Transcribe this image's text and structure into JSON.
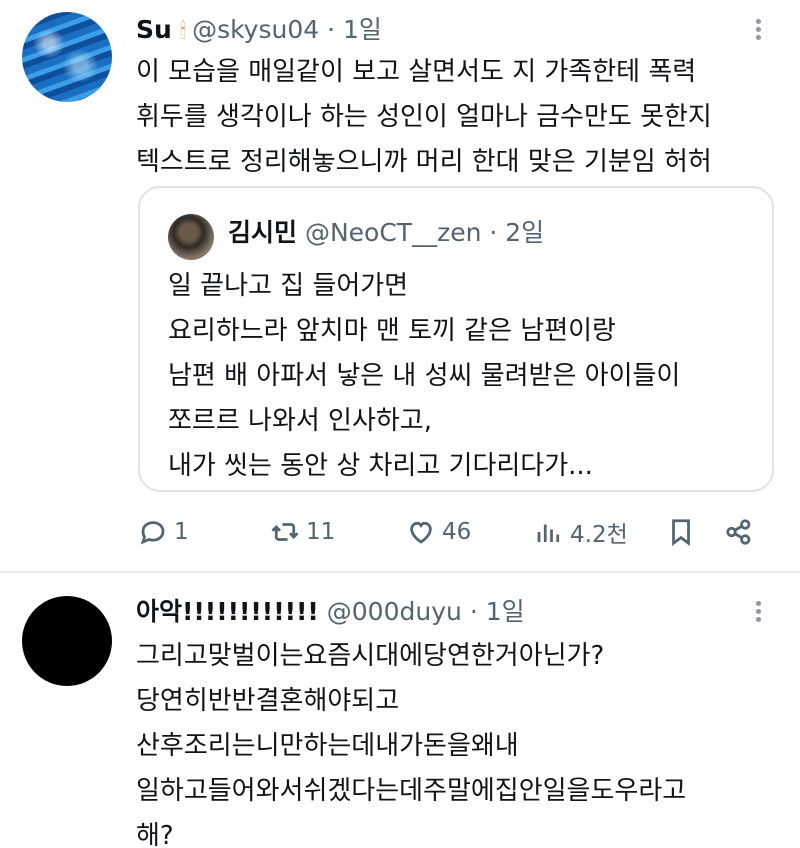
{
  "tweet1": {
    "name": "Su",
    "handle": "@skysu04",
    "separator": "·",
    "time": "1일",
    "lines": [
      "이 모습을 매일같이 보고 살면서도 지 가족한테 폭력",
      "휘두를 생각이나 하는 성인이 얼마나 금수만도 못한지",
      "텍스트로 정리해놓으니까 머리 한대 맞은 기분임 허허"
    ],
    "quote": {
      "name": "김시민",
      "handle": "@NeoCT__zen",
      "separator": "·",
      "time": "2일",
      "lines": [
        "일 끝나고 집 들어가면",
        "요리하느라 앞치마 맨 토끼 같은 남편이랑",
        "남편 배 아파서 낳은 내 성씨 물려받은 아이들이",
        "쪼르르 나와서 인사하고,",
        "내가 씻는 동안 상 차리고 기다리다가..."
      ]
    },
    "actions": {
      "replies": "1",
      "retweets": "11",
      "likes": "46",
      "views": "4.2천"
    }
  },
  "tweet2": {
    "name": "아악!!!!!!!!!!!!",
    "handle": "@000duyu",
    "separator": "·",
    "time": "1일",
    "lines": [
      "그리고맞벌이는요즘시대에당연한거아닌가?",
      "당연히반반결혼해야되고",
      "산후조리는니만하는데내가돈을왜내",
      "일하고들어와서쉬겠다는데주말에집안일을도우라고",
      "해?"
    ]
  }
}
